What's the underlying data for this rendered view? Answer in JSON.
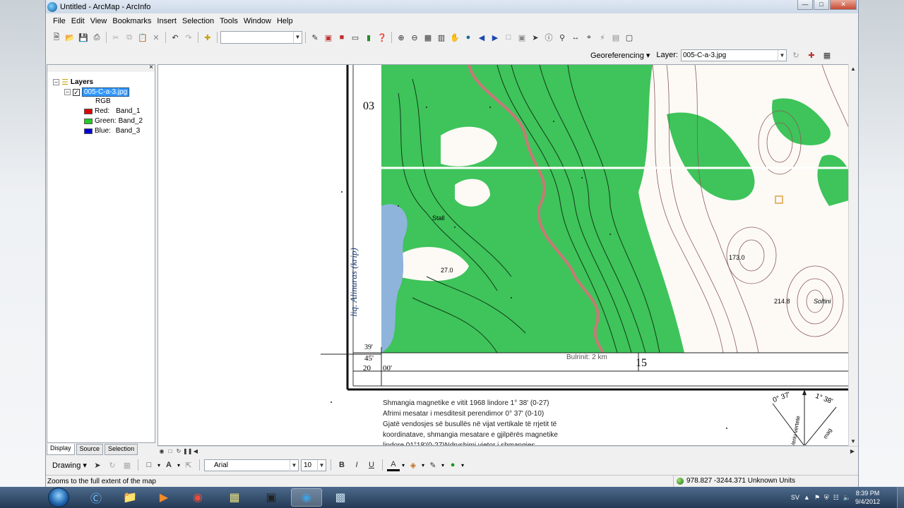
{
  "window": {
    "title": "Untitled - ArcMap - ArcInfo"
  },
  "menu": [
    "File",
    "Edit",
    "View",
    "Bookmarks",
    "Insert",
    "Selection",
    "Tools",
    "Window",
    "Help"
  ],
  "georef": {
    "label": "Georeferencing",
    "layer_label": "Layer:",
    "layer_value": "005-C-a-3.jpg"
  },
  "toc": {
    "root": "Layers",
    "layer": "005-C-a-3.jpg",
    "rgb": "RGB",
    "bands": [
      {
        "label": "Red:",
        "band": "Band_1",
        "color": "#e00000"
      },
      {
        "label": "Green:",
        "band": "Band_2",
        "color": "#22cc22"
      },
      {
        "label": "Blue:",
        "band": "Band_3",
        "color": "#0000dd"
      }
    ],
    "tabs": [
      "Display",
      "Source",
      "Selection"
    ]
  },
  "map": {
    "grid_top": "03",
    "corner_lat1": "39'",
    "corner_lat2": "45'",
    "corner_lon": "20",
    "corner_min": "00'",
    "lake": "liq. Alinuras (krip)",
    "scale_text": "Bulrinit: 2 km",
    "grid_bottom": "15",
    "spot_a": "27.0",
    "spot_b": "214.8",
    "spot_c": "Soltini",
    "spot_d": "173.0",
    "village": "Stall",
    "legend": [
      "Shmangia magnetike e vitit 1968 lindore 1° 38' (0-27)",
      "Afrimi mesatar i mesditesit perendimor 0° 37' (0-10)",
      "Gjatë vendosjes së busullës në vijat vertikale të rrjetit të",
      "koordinatave, shmangia mesatare e gjilpërës magnetike",
      "lindore 01°18'(0-27)Ndryshimi vjetor i shmangies"
    ],
    "diag_left": "0° 37'",
    "diag_right": "1° 38'",
    "diag_a": "Veriu vertete",
    "diag_b": "mag"
  },
  "drawing": {
    "label": "Drawing",
    "font": "Arial",
    "size": "10"
  },
  "status": {
    "message": "Zooms to the full extent of the map",
    "coords": "978.827  -3244.371 Unknown Units"
  },
  "taskbar": {
    "lang": "SV",
    "time": "8:39 PM",
    "date": "9/4/2012"
  }
}
